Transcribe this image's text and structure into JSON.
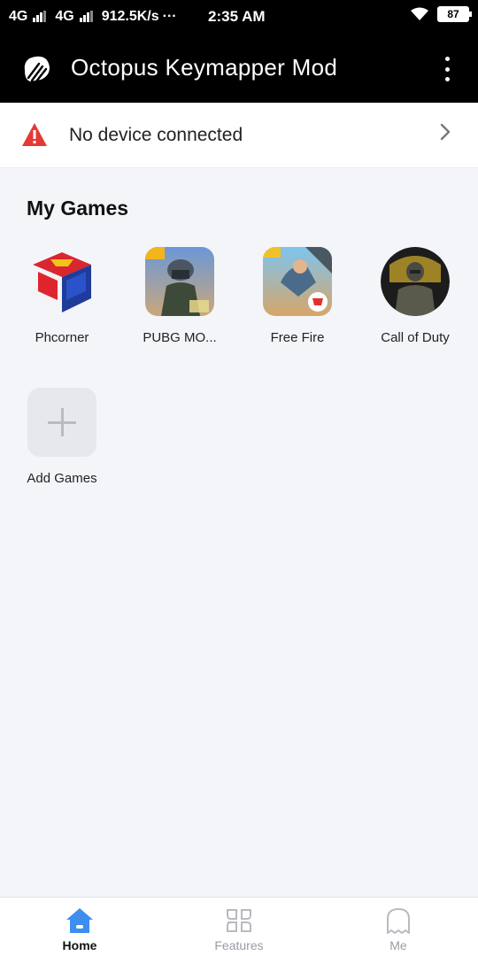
{
  "status_bar": {
    "network1": "4G",
    "network2": "4G",
    "speed": "912.5K/s",
    "more": "···",
    "time": "2:35 AM",
    "battery": "87"
  },
  "app_bar": {
    "title": "Octopus Keymapper Mod",
    "menu_icon": "more-vert-icon"
  },
  "device": {
    "status_text": "No device connected",
    "status_color": "#e53935"
  },
  "my_games": {
    "title": "My Games",
    "games": [
      {
        "label": "Phcorner",
        "icon": "phcorner-cube-icon"
      },
      {
        "label": "PUBG MO...",
        "icon": "pubg-icon"
      },
      {
        "label": "Free Fire",
        "icon": "free-fire-icon"
      },
      {
        "label": "Call of Duty",
        "icon": "call-of-duty-icon"
      }
    ],
    "add_label": "Add Games"
  },
  "bottom_nav": {
    "items": [
      {
        "label": "Home",
        "icon": "home-icon",
        "active": true
      },
      {
        "label": "Features",
        "icon": "features-grid-icon",
        "active": false
      },
      {
        "label": "Me",
        "icon": "ghost-profile-icon",
        "active": false
      }
    ],
    "accent_color": "#3d8ef0"
  }
}
